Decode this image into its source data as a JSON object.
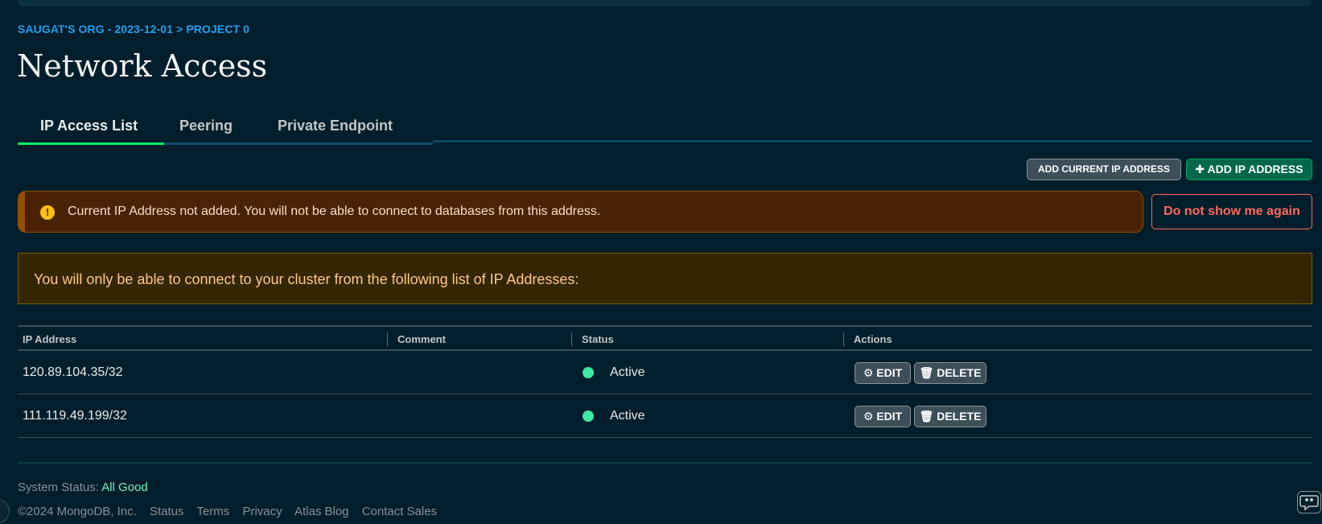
{
  "breadcrumb": "SAUGAT'S ORG - 2023-12-01 > PROJECT 0",
  "page_title": "Network Access",
  "tabs": [
    {
      "label": "IP Access List",
      "active": true
    },
    {
      "label": "Peering",
      "active": false
    },
    {
      "label": "Private Endpoint",
      "active": false
    }
  ],
  "actions": {
    "add_current_ip": "ADD CURRENT IP ADDRESS",
    "add_ip": "ADD IP ADDRESS",
    "add_ip_icon": "plus-icon"
  },
  "warning": {
    "icon": "warning-icon",
    "message": "Current IP Address not added. You will not be able to connect to databases from this address.",
    "dismiss": "Do not show me again"
  },
  "info_banner": "You will only be able to connect to your cluster from the following list of IP Addresses:",
  "table": {
    "headers": [
      "IP Address",
      "Comment",
      "Status",
      "Actions"
    ],
    "rows": [
      {
        "ip": "120.89.104.35/32",
        "comment": "",
        "status": "Active",
        "edit": "EDIT",
        "delete": "DELETE"
      },
      {
        "ip": "111.119.49.199/32",
        "comment": "",
        "status": "Active",
        "edit": "EDIT",
        "delete": "DELETE"
      }
    ]
  },
  "footer": {
    "system_status_label": "System Status:",
    "system_status_value": "All Good",
    "copyright": "©2024 MongoDB, Inc.",
    "links": [
      "Status",
      "Terms",
      "Privacy",
      "Atlas Blog",
      "Contact Sales"
    ]
  },
  "colors": {
    "background": "#001e2b",
    "accent_green": "#00ed64",
    "link_blue": "#1da1f2",
    "status_active": "#3ee8a5",
    "danger": "#ff6960"
  }
}
